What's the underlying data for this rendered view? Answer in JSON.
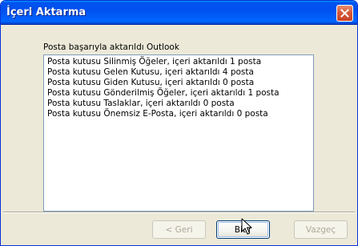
{
  "window": {
    "title": "İçeri Aktarma"
  },
  "icons": {
    "close": "close-icon",
    "cursor": "mouse-pointer-icon"
  },
  "main": {
    "status_label": "Posta başarıyla aktarıldı Outlook",
    "log_lines": [
      "Posta kutusu Silinmiş Öğeler, içeri aktarıldı 1 posta",
      "Posta kutusu Gelen Kutusu, içeri aktarıldı 4 posta",
      "Posta kutusu Giden Kutusu, içeri aktarıldı 0 posta",
      "Posta kutusu Gönderilmiş Öğeler, içeri aktarıldı 1 posta",
      "Posta kutusu Taslaklar, içeri aktarıldı 0 posta",
      "Posta kutusu Önemsiz E-Posta, içeri aktarıldı 0 posta"
    ]
  },
  "buttons": {
    "back_label": "< Geri",
    "finish_label": "Bitir",
    "cancel_label": "Vazgeç"
  },
  "colors": {
    "titlebar": "#0054e3",
    "dialog_bg": "#ece9d8",
    "close_button": "#d75a3b"
  }
}
